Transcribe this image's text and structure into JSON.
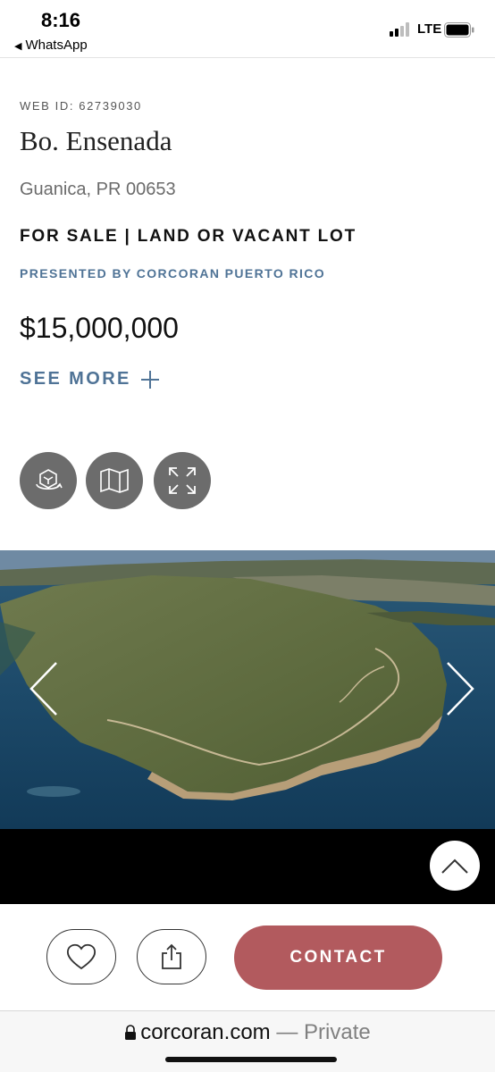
{
  "status_bar": {
    "time": "8:16",
    "back_label": "WhatsApp",
    "network": "LTE"
  },
  "listing": {
    "web_id": "WEB ID: 62739030",
    "title": "Bo. Ensenada",
    "address": "Guanica, PR 00653",
    "sale_type": "FOR SALE | LAND OR VACANT LOT",
    "presented_by": "PRESENTED BY CORCORAN PUERTO RICO",
    "price": "$15,000,000",
    "see_more_label": "SEE MORE"
  },
  "media_buttons": [
    {
      "icon": "3d-tour-icon"
    },
    {
      "icon": "map-icon"
    },
    {
      "icon": "expand-icon"
    }
  ],
  "photo": {
    "description_icon": "aerial-coastline-photo"
  },
  "actions": {
    "contact_label": "CONTACT"
  },
  "browser": {
    "domain": "corcoran.com",
    "mode": "— Private"
  },
  "colors": {
    "accent_blue": "#4f7396",
    "contact_red": "#b25a5e",
    "icon_gray": "#6c6c6c"
  }
}
